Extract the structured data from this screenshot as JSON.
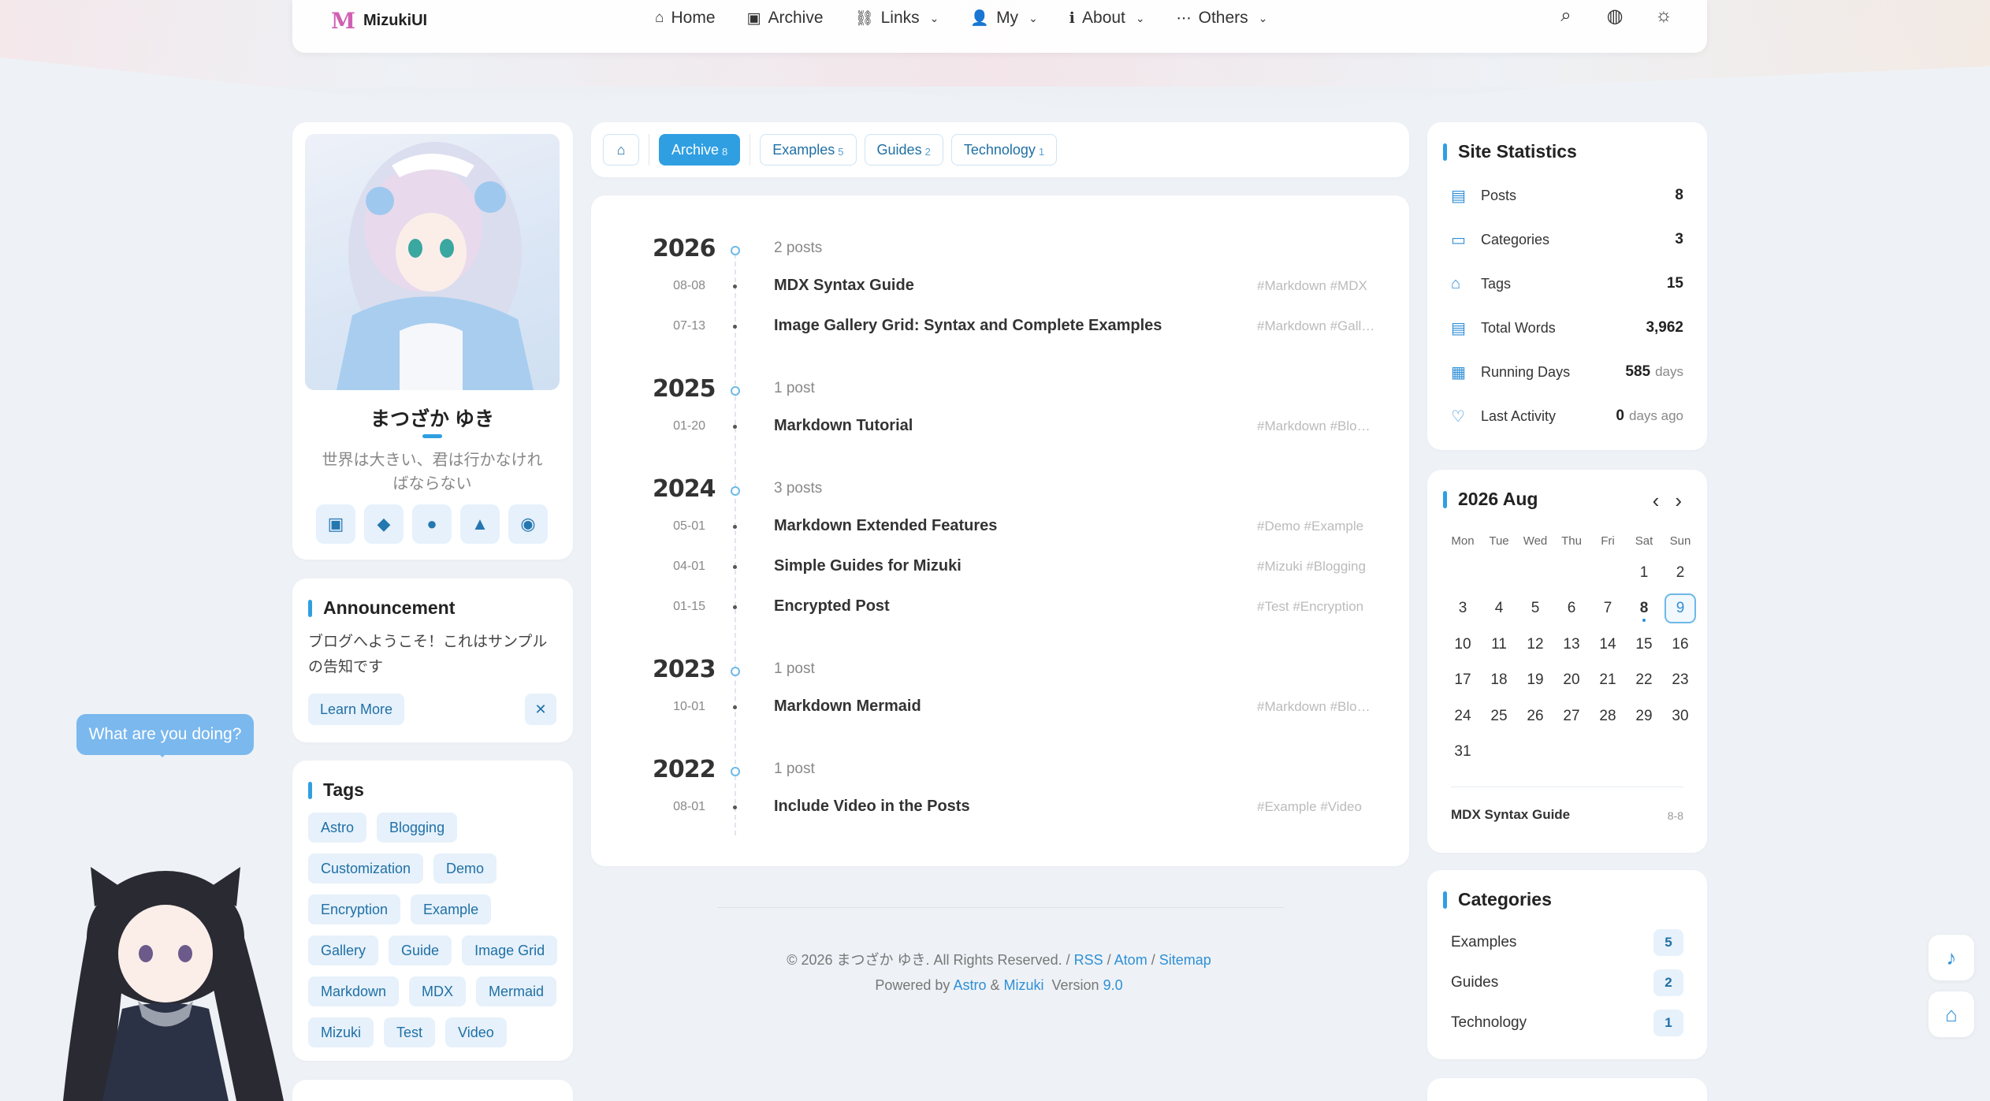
{
  "brand": {
    "logo": "M",
    "name": "MizukiUI"
  },
  "nav": {
    "links": [
      {
        "icon": "⌂",
        "label": "Home",
        "dropdown": false
      },
      {
        "icon": "▣",
        "label": "Archive",
        "dropdown": false
      },
      {
        "icon": "⛓",
        "label": "Links",
        "dropdown": true
      },
      {
        "icon": "👤",
        "label": "My",
        "dropdown": true
      },
      {
        "icon": "ℹ",
        "label": "About",
        "dropdown": true
      },
      {
        "icon": "⋯",
        "label": "Others",
        "dropdown": true
      }
    ],
    "icons": [
      "search-icon",
      "palette-icon",
      "sun-icon"
    ]
  },
  "profile": {
    "name": "まつざか ゆき",
    "motto": "世界は大きい、君は行かなければならない",
    "socials": [
      "bilibili-icon",
      "git-icon",
      "github-icon",
      "codeberg-icon",
      "discord-icon"
    ]
  },
  "announcement": {
    "title": "Announcement",
    "text": "ブログへようこそ！これはサンプルの告知です",
    "learn_more": "Learn More",
    "close": "✕"
  },
  "tags": {
    "title": "Tags",
    "items": [
      "Astro",
      "Blogging",
      "Customization",
      "Demo",
      "Encryption",
      "Example",
      "Gallery",
      "Guide",
      "Image Grid",
      "Markdown",
      "MDX",
      "Mermaid",
      "Mizuki",
      "Test",
      "Video"
    ]
  },
  "filters": [
    {
      "label": "Archive",
      "count": "8",
      "active": true
    },
    {
      "label": "Examples",
      "count": "5",
      "active": false
    },
    {
      "label": "Guides",
      "count": "2",
      "active": false
    },
    {
      "label": "Technology",
      "count": "1",
      "active": false
    }
  ],
  "archive": [
    {
      "year": "2026",
      "count": "2 posts",
      "posts": [
        {
          "date": "08-08",
          "title": "MDX Syntax Guide",
          "tags": "#Markdown #MDX"
        },
        {
          "date": "07-13",
          "title": "Image Gallery Grid: Syntax and Complete Examples",
          "tags": "#Markdown #Gallery"
        }
      ]
    },
    {
      "year": "2025",
      "count": "1 post",
      "posts": [
        {
          "date": "01-20",
          "title": "Markdown Tutorial",
          "tags": "#Markdown #Blogging"
        }
      ]
    },
    {
      "year": "2024",
      "count": "3 posts",
      "posts": [
        {
          "date": "05-01",
          "title": "Markdown Extended Features",
          "tags": "#Demo #Example"
        },
        {
          "date": "04-01",
          "title": "Simple Guides for Mizuki",
          "tags": "#Mizuki #Blogging"
        },
        {
          "date": "01-15",
          "title": "Encrypted Post",
          "tags": "#Test #Encryption"
        }
      ]
    },
    {
      "year": "2023",
      "count": "1 post",
      "posts": [
        {
          "date": "10-01",
          "title": "Markdown Mermaid",
          "tags": "#Markdown #Blogging"
        }
      ]
    },
    {
      "year": "2022",
      "count": "1 post",
      "posts": [
        {
          "date": "08-01",
          "title": "Include Video in the Posts",
          "tags": "#Example #Video"
        }
      ]
    }
  ],
  "footer": {
    "copyright": "© 2026 まつざか ゆき. All Rights Reserved. /",
    "rss": "RSS",
    "atom": "Atom",
    "sitemap": "Sitemap",
    "sep": "/",
    "powered_by": "Powered by",
    "astro": "Astro",
    "amp": "&",
    "mizuki": "Mizuki",
    "version_label": "Version",
    "version": "9.0"
  },
  "stats": {
    "title": "Site Statistics",
    "items": [
      {
        "icon": "▤",
        "label": "Posts",
        "value": "8",
        "unit": ""
      },
      {
        "icon": "▭",
        "label": "Categories",
        "value": "3",
        "unit": ""
      },
      {
        "icon": "⌂",
        "label": "Tags",
        "value": "15",
        "unit": ""
      },
      {
        "icon": "▤",
        "label": "Total Words",
        "value": "3,962",
        "unit": ""
      },
      {
        "icon": "▦",
        "label": "Running Days",
        "value": "585",
        "unit": "days"
      },
      {
        "icon": "♡",
        "label": "Last Activity",
        "value": "0",
        "unit": "days ago"
      }
    ]
  },
  "calendar": {
    "title": "2026 Aug",
    "weekdays": [
      "Mon",
      "Tue",
      "Wed",
      "Thu",
      "Fri",
      "Sat",
      "Sun"
    ],
    "leading_blanks": 5,
    "days": 31,
    "today": 9,
    "post_days": [
      8
    ],
    "event": {
      "title": "MDX Syntax Guide",
      "date": "8-8"
    }
  },
  "categories": {
    "title": "Categories",
    "items": [
      {
        "name": "Examples",
        "count": "5"
      },
      {
        "name": "Guides",
        "count": "2"
      },
      {
        "name": "Technology",
        "count": "1"
      }
    ]
  },
  "mascot": {
    "bubble": "What are you doing?"
  },
  "float_buttons": [
    "music-icon",
    "home-icon"
  ],
  "colors": {
    "accent": "#2f9fe2",
    "brand": "#d15fb4"
  }
}
